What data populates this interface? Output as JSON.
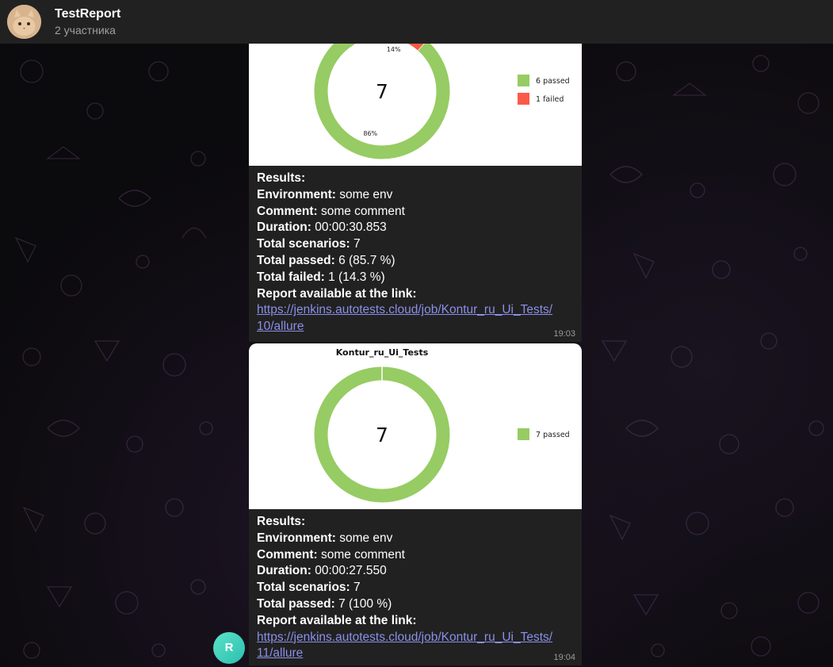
{
  "header": {
    "title": "TestReport",
    "subtitle": "2 участника"
  },
  "user_avatar_letter": "R",
  "colors": {
    "passed": "#96cc63",
    "failed": "#fc5a47",
    "link": "#8b8fe8",
    "bubble": "#212121"
  },
  "messages": [
    {
      "results_label": "Results:",
      "environment_label": "Environment:",
      "environment_value": " some env",
      "comment_label": "Comment:",
      "comment_value": " some comment",
      "duration_label": "Duration:",
      "duration_value": " 00:00:30.853",
      "total_scenarios_label": "Total scenarios:",
      "total_scenarios_value": " 7",
      "total_passed_label": "Total passed:",
      "total_passed_value": " 6 (85.7 %)",
      "total_failed_label": "Total failed:",
      "total_failed_value": " 1 (14.3 %)",
      "report_label": "Report available at the link:",
      "link_line1": "https://jenkins.autotests.cloud/job/Kontur_ru_Ui_Tests/",
      "link_line2": "10/allure",
      "time": "19:03"
    },
    {
      "results_label": "Results:",
      "environment_label": "Environment:",
      "environment_value": " some env",
      "comment_label": "Comment:",
      "comment_value": " some comment",
      "duration_label": "Duration:",
      "duration_value": " 00:00:27.550",
      "total_scenarios_label": "Total scenarios:",
      "total_scenarios_value": " 7",
      "total_passed_label": "Total passed:",
      "total_passed_value": " 7 (100 %)",
      "report_label": "Report available at the link:",
      "link_line1": "https://jenkins.autotests.cloud/job/Kontur_ru_Ui_Tests/",
      "link_line2": "11/allure",
      "time": "19:04"
    }
  ],
  "chart_data": [
    {
      "type": "pie",
      "title": "",
      "center_label": "7",
      "series": [
        {
          "name": "6 passed",
          "value": 6,
          "percent_label": "86%",
          "color": "#96cc63"
        },
        {
          "name": "1 failed",
          "value": 1,
          "percent_label": "14%",
          "color": "#fc5a47"
        }
      ],
      "legend": "right"
    },
    {
      "type": "pie",
      "title": "Kontur_ru_Ui_Tests",
      "center_label": "7",
      "series": [
        {
          "name": "7 passed",
          "value": 7,
          "percent_label": "",
          "color": "#96cc63"
        }
      ],
      "legend": "right"
    }
  ]
}
